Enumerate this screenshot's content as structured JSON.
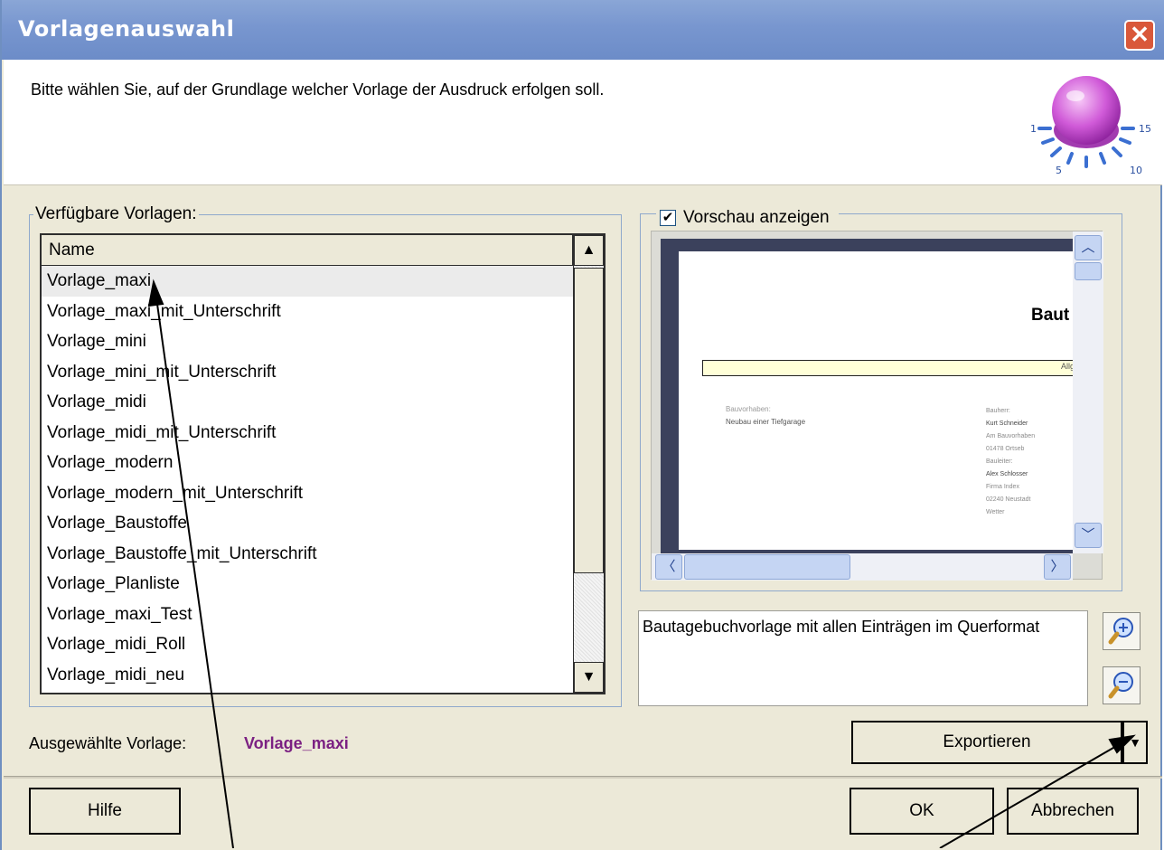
{
  "window": {
    "title": "Vorlagenauswahl",
    "close_glyph": "✕"
  },
  "header": {
    "instruction": "Bitte wählen Sie, auf der Grundlage welcher Vorlage der Ausdruck erfolgen soll.",
    "dial_labels": [
      "1",
      "5",
      "10",
      "15"
    ]
  },
  "templates": {
    "legend": "Verfügbare Vorlagen:",
    "column_header": "Name",
    "items": [
      "Vorlage_maxi",
      "Vorlage_maxi_mit_Unterschrift",
      "Vorlage_mini",
      "Vorlage_mini_mit_Unterschrift",
      "Vorlage_midi",
      "Vorlage_midi_mit_Unterschrift",
      "Vorlage_modern",
      "Vorlage_modern_mit_Unterschrift",
      "Vorlage_Baustoffe",
      "Vorlage_Baustoffe_mit_Unterschrift",
      "Vorlage_Planliste",
      "Vorlage_maxi_Test",
      "Vorlage_midi_Roll",
      "Vorlage_midi_neu"
    ],
    "selected_index": 0
  },
  "preview": {
    "checkbox_label": "Vorschau anzeigen",
    "checked": true,
    "page_title": "Baut",
    "page_subtitle": "Allg",
    "left_label": "Bauvorhaben:",
    "left_value": "Neubau einer Tiefgarage",
    "right_lines": [
      "Bauherr:",
      "Kurt Schneider",
      "Am Bauvorhaben",
      "01478 Ortseb",
      "Bauleiter:",
      "Alex Schlosser",
      "Firma Index",
      "02240 Neustadt",
      "Wetter"
    ]
  },
  "description": "Bautagebuchvorlage mit allen Einträgen im Querformat",
  "selected": {
    "label": "Ausgewählte Vorlage:",
    "value": "Vorlage_maxi",
    "color": "#7b2082"
  },
  "buttons": {
    "export": "Exportieren",
    "help": "Hilfe",
    "ok": "OK",
    "cancel": "Abbrechen"
  },
  "colors": {
    "title_bar": "#7896cf",
    "close": "#d9583a",
    "accent": "#7b2082"
  }
}
